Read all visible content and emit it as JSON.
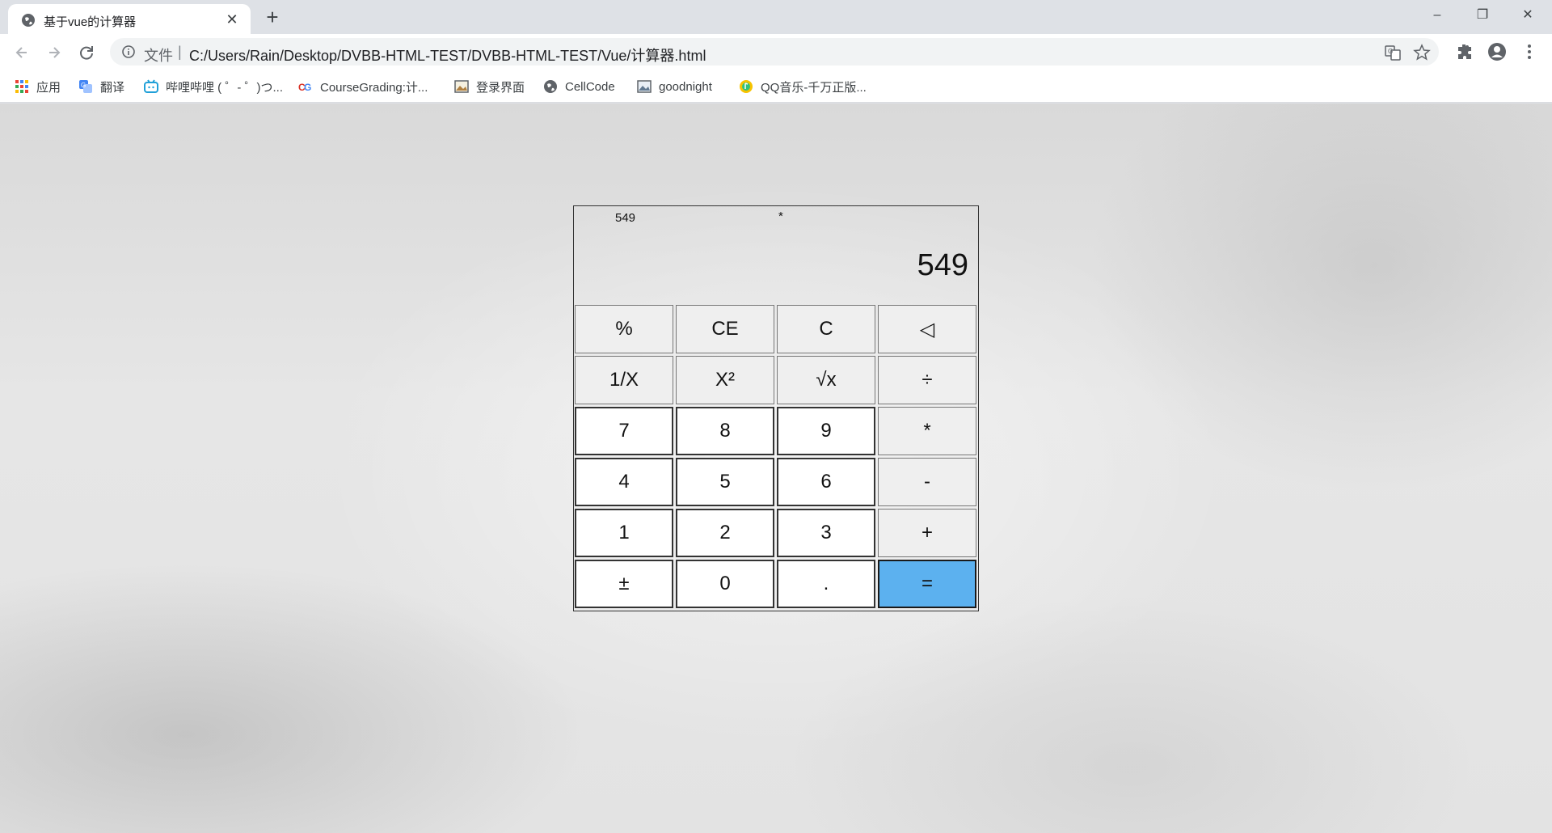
{
  "browser": {
    "tab_title": "基于vue的计算器",
    "tab_close": "✕",
    "new_tab": "+",
    "window_controls": {
      "minimize": "–",
      "maximize": "❐",
      "close": "✕"
    },
    "scheme_label": "文件",
    "url": "C:/Users/Rain/Desktop/DVBB-HTML-TEST/DVBB-HTML-TEST/Vue/计算器.html",
    "bookmarks": [
      {
        "label": "应用",
        "icon": "apps-grid-icon"
      },
      {
        "label": "翻译",
        "icon": "translate-icon"
      },
      {
        "label": "哔哩哔哩 ( ゜- ゜)つ...",
        "icon": "bilibili-icon"
      },
      {
        "label": "CourseGrading:计...",
        "icon": "coursegrading-icon"
      },
      {
        "label": "登录界面",
        "icon": "image-icon"
      },
      {
        "label": "CellCode",
        "icon": "globe-icon"
      },
      {
        "label": "goodnight",
        "icon": "image-icon"
      },
      {
        "label": "QQ音乐-千万正版...",
        "icon": "qq-music-icon"
      }
    ]
  },
  "calculator": {
    "previous_value": "549",
    "operator": "*",
    "current_value": "549",
    "keys": [
      [
        "%",
        "CE",
        "C",
        "◁"
      ],
      [
        "1/X",
        "X²",
        "√x",
        "÷"
      ],
      [
        "7",
        "8",
        "9",
        "*"
      ],
      [
        "4",
        "5",
        "6",
        "-"
      ],
      [
        "1",
        "2",
        "3",
        "+"
      ],
      [
        "±",
        "0",
        ".",
        "="
      ]
    ]
  },
  "colors": {
    "equals_key": "#5cb1ef",
    "function_key": "#efefef",
    "number_key": "#ffffff"
  }
}
